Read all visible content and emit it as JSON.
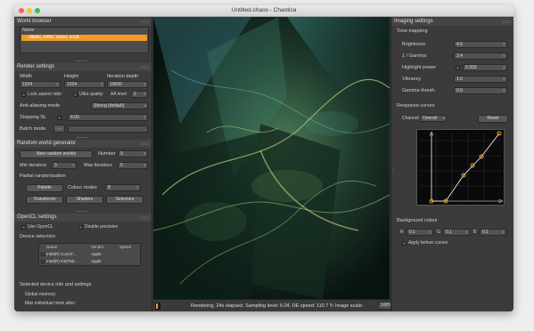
{
  "window": {
    "title": "Untitled.chaos - Chaotica"
  },
  "world_browser": {
    "title": "World browser",
    "column_name": "Name",
    "selected_world": "elliptic, ortho, super, scryt."
  },
  "render_settings": {
    "title": "Render settings",
    "width_label": "Width",
    "height_label": "Height",
    "iteration_depth_label": "Iteration depth",
    "width": "1024",
    "height": "1024",
    "iteration_depth": "10000",
    "lock_aspect_label": "Lock aspect ratio",
    "ultra_quality_label": "Ultra quality",
    "aa_level_label": "AA level",
    "aa_level": "2",
    "antialiasing_mode_label": "Anti-aliasing mode",
    "antialiasing_mode": "Strong (default)",
    "stopping_sl_label": "Stopping SL",
    "stopping_sl": "8.00",
    "batch_mode_label": "Batch mode",
    "batch_mode_button": "..."
  },
  "random_world": {
    "title": "Random world generator",
    "new_random_worlds": "New random worlds",
    "number_label": "Number",
    "number": "9",
    "min_iterators_label": "Min iterators",
    "min_iterators": "3",
    "max_iterators_label": "Max iterators",
    "max_iterators": "5",
    "partial_label": "Partial randomisation",
    "palette": "Palette",
    "colour_nodes_label": "Colour nodes",
    "colour_nodes": "8",
    "transforms": "Transforms",
    "shaders": "Shaders",
    "selectors": "Selectors"
  },
  "opencl": {
    "title": "OpenCL settings",
    "use_opencl_label": "Use OpenCL",
    "double_precision_label": "Double precision",
    "device_selection_label": "Device selection",
    "columns": [
      "Name",
      "Vendor",
      "Speed"
    ],
    "devices": [
      {
        "name": "Intel(R) Core(T...",
        "vendor": "Apple"
      },
      {
        "name": "Intel(R) Iris(TM)...",
        "vendor": "Apple"
      }
    ],
    "selected_device_info_label": "Selected device info and settings",
    "global_memory_label": "Global memory:",
    "max_alloc_label": "Max individual mem alloc:"
  },
  "imaging": {
    "title": "Imaging settings",
    "tone_mapping_label": "Tone mapping",
    "brightness_label": "Brightness",
    "brightness": "4.5",
    "gamma_label": "1 / Gamma",
    "gamma": "3.4",
    "highlight_power_label": "Highlight power",
    "highlight_power": "0.303",
    "vibrancy_label": "Vibrancy",
    "vibrancy": "1.0",
    "gamma_thresh_label": "Gamma thresh.",
    "gamma_thresh": "0.0",
    "response_curves_label": "Response curves",
    "channel_label": "Channel:",
    "channel": "Overall",
    "reset": "Reset",
    "background_colour_label": "Background colour",
    "r_label": "R",
    "r": "0.1",
    "g_label": "G",
    "g": "0.1",
    "b_label": "B",
    "b": "0.1",
    "apply_before_curves_label": "Apply before curves"
  },
  "status": {
    "text": "Rendering, 24s elapsed. Sampling level: 6.04, DE speed: 110.7 ↻ Image scale:",
    "zoom": "100%",
    "progress": 0.6
  },
  "colors": {
    "accent": "#f09a27",
    "panel": "#3b3b3b",
    "canvas_dark": "#0c1712"
  }
}
